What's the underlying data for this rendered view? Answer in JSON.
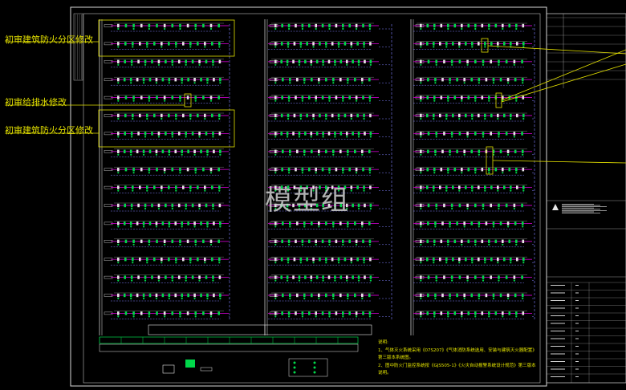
{
  "annotations": {
    "fire_zone_top": "初审建筑防火分区修改",
    "water_supply": "初审给排水修改",
    "fire_zone_mid": "初审建筑防火分区修改"
  },
  "watermark": "模型组",
  "notes": {
    "heading": "说明:",
    "line1": "1、气体灭火系统采用《07S207》《气体消防系统选用、安装与建筑灭火器配置》",
    "line2": "  第三版本系统图。",
    "line3": "2、图中防火门监控系统按《GJS505-1》《火灾自动报警系统设计规范》第三版本",
    "line4": "  说明。"
  },
  "colors": {
    "background": "#000000",
    "frame": "#d9d9d9",
    "annotation": "#e3e000",
    "riser_dashed": "#8080ff",
    "floor_bus": "#c000c0",
    "device_green": "#00d84a",
    "device_white": "#e6e6e6"
  },
  "columns": 3,
  "floors_per_column": 17
}
